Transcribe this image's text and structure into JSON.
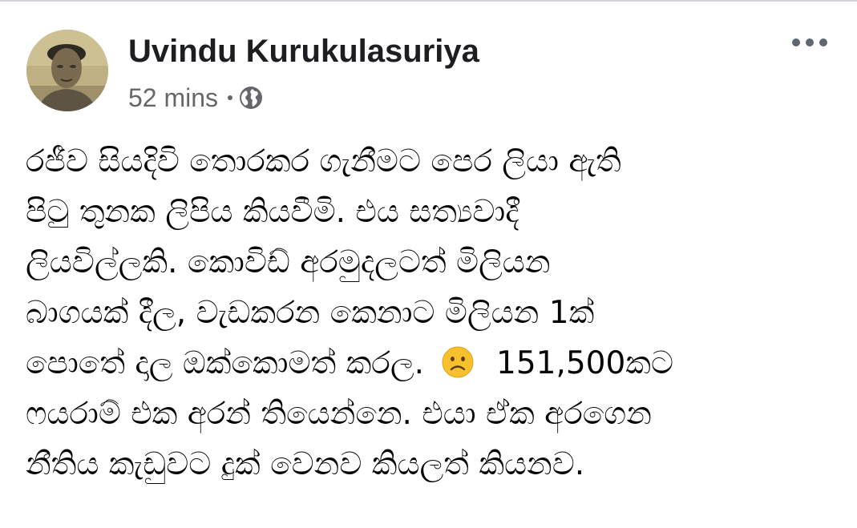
{
  "post": {
    "author": "Uvindu Kurukulasuriya",
    "timestamp": "52 mins",
    "privacy_icon": "globe-icon",
    "menu_icon": "more-options-icon",
    "avatar": "profile-photo",
    "body_lines": [
      "රජීව සියදිවි තොරකර ගැනීමට පෙර ලියා ඇති",
      "පිටු තුනක ලිපිය කියවීමි. එය සත්‍යවාදී",
      "ලියවිල්ලකි. කොවිඩ් අරමුදලටත් මිලියන",
      "බාගයක් දීල, වැඩකරන කෙනාට මිලියන 1ක්",
      "පොතේ දාල ඔක්කොමත් කරල.",
      "ෆයරාම් එක අරන් තියෙන්නෙ. එයා ඒක අරගෙන",
      "නීතිය කැඩුවට දුක් වෙනව කියලත් කියනව."
    ],
    "line5_after_emoji": "151,500කට",
    "emoji": "frowning-face-emoji"
  },
  "colors": {
    "author_text": "#1c1e21",
    "meta_text": "#65676b",
    "body_text": "#050505",
    "emoji_face": "#f7c12e"
  }
}
